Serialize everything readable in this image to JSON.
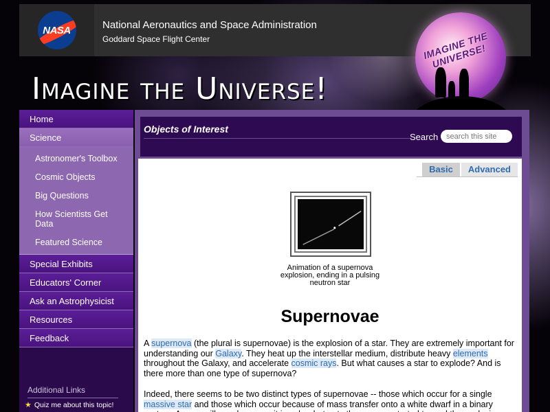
{
  "header": {
    "logo_text": "NASA",
    "agency": "National Aeronautics and Space Administration",
    "center": "Goddard Space Flight Center",
    "site_logo_text": "IMAGINE THE UNIVERSE!"
  },
  "banner": {
    "title": "Imagine the Universe!"
  },
  "nav": {
    "items": [
      {
        "label": "Home"
      },
      {
        "label": "Science"
      },
      {
        "label": "Special Exhibits"
      },
      {
        "label": "Educators' Corner"
      },
      {
        "label": "Ask an Astrophysicist"
      },
      {
        "label": "Resources"
      },
      {
        "label": "Feedback"
      }
    ],
    "science_sub": [
      {
        "label": "Astronomer's Toolbox"
      },
      {
        "label": "Cosmic Objects"
      },
      {
        "label": "Big Questions"
      },
      {
        "label": "How Scientists Get Data"
      },
      {
        "label": "Featured Science"
      }
    ],
    "additional_links": "Additional Links",
    "quiz": "Quiz me about this topic!"
  },
  "section": {
    "title": "Objects of Interest"
  },
  "search": {
    "label": "Search",
    "placeholder": "search this site"
  },
  "tabs": {
    "basic": "Basic",
    "advanced": "Advanced"
  },
  "animation": {
    "caption": "Animation of a supernova explosion, ending in a pulsing neutron star"
  },
  "article": {
    "title": "Supernovae",
    "p1": {
      "t1": "A ",
      "l1": "supernova",
      "t2": " (the plural is supernovae) is the explosion of a star. They are extremely important for understanding our ",
      "l2": "Galaxy",
      "t3": ". They heat up the interstellar medium, distribute heavy ",
      "l3": "elements",
      "t4": " throughout the Galaxy, and accelerate ",
      "l4": "cosmic rays",
      "t5": ". But what causes a star to explode? And is there more than one type of supernova?"
    },
    "p2": {
      "t1": "Indeed, there seems to be two distinct types of supernovae -- those which occur for a single ",
      "l1": "massive star",
      "t2": " and those which occur because of mass transfer onto a white dwarf in a binary system. As you will see, however, it is only what gets the process started toward the explosion"
    }
  },
  "colors": {
    "nav_purple": "#5b1e97",
    "nav_active": "#9a6fbd",
    "section_bar": "#2e0a52",
    "link": "#2f6bb0"
  }
}
